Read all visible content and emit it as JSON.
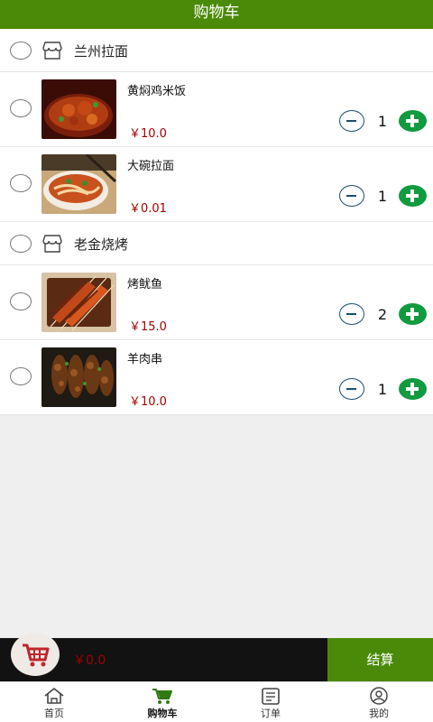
{
  "header": {
    "title": "购物车"
  },
  "shops": [
    {
      "name": "兰州拉面",
      "items": [
        {
          "name": "黄焖鸡米饭",
          "price": "￥10.0",
          "qty": "1"
        },
        {
          "name": "大碗拉面",
          "price": "￥0.01",
          "qty": "1"
        }
      ]
    },
    {
      "name": "老金烧烤",
      "items": [
        {
          "name": "烤鱿鱼",
          "price": "￥15.0",
          "qty": "2"
        },
        {
          "name": "羊肉串",
          "price": "￥10.0",
          "qty": "1"
        }
      ]
    }
  ],
  "footer": {
    "total": "￥0.0",
    "checkout_label": "结算"
  },
  "tabs": [
    {
      "label": "首页",
      "icon": "home-icon"
    },
    {
      "label": "购物车",
      "icon": "cart-icon"
    },
    {
      "label": "订单",
      "icon": "order-icon"
    },
    {
      "label": "我的",
      "icon": "user-icon"
    }
  ],
  "colors": {
    "brand_green": "#4b8a08",
    "price_red": "#a30000",
    "plus_green": "#119a3f",
    "minus_blue": "#1b4e6e",
    "cart_red": "#c0262f"
  }
}
